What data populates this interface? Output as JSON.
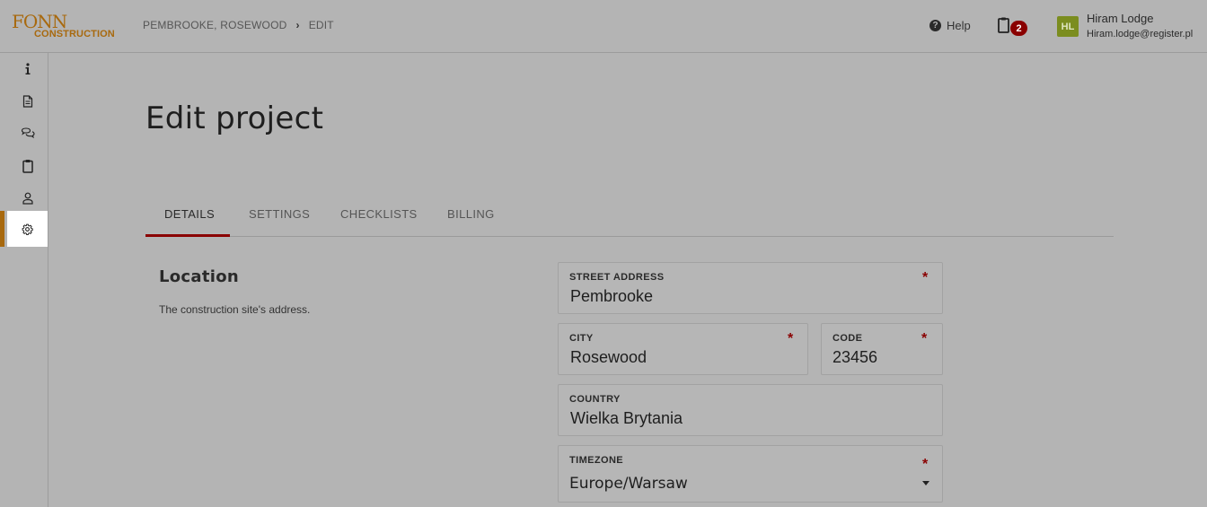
{
  "logo": {
    "line1": "FONN",
    "line2": "CONSTRUCTION"
  },
  "breadcrumb": {
    "items": [
      "PEMBROOKE, ROSEWOOD",
      "EDIT"
    ]
  },
  "header": {
    "help_label": "Help",
    "notification_count": "2",
    "user": {
      "initials": "HL",
      "name": "Hiram Lodge",
      "email": "Hiram.lodge@register.pl"
    }
  },
  "sidebar": {
    "items": [
      {
        "icon": "info-icon"
      },
      {
        "icon": "document-icon"
      },
      {
        "icon": "chat-icon"
      },
      {
        "icon": "clipboard-icon"
      },
      {
        "icon": "user-icon"
      },
      {
        "icon": "gear-icon",
        "active": true
      }
    ]
  },
  "main": {
    "title": "Edit project",
    "tabs": [
      {
        "label": "DETAILS",
        "active": true
      },
      {
        "label": "SETTINGS"
      },
      {
        "label": "CHECKLISTS"
      },
      {
        "label": "BILLING"
      }
    ],
    "section": {
      "title": "Location",
      "description": "The construction site's address."
    },
    "fields": {
      "street": {
        "label": "STREET ADDRESS",
        "value": "Pembrooke",
        "required": "*"
      },
      "city": {
        "label": "CITY",
        "value": "Rosewood",
        "required": "*"
      },
      "code": {
        "label": "CODE",
        "value": "23456",
        "required": "*"
      },
      "country": {
        "label": "COUNTRY",
        "value": "Wielka Brytania"
      },
      "timezone": {
        "label": "TIMEZONE",
        "value": "Europe/Warsaw",
        "required": "*"
      }
    }
  },
  "colors": {
    "brand": "#a8690e",
    "accent": "#8a0000",
    "avatar": "#7b8d1f",
    "background": "#b4b4b4"
  }
}
